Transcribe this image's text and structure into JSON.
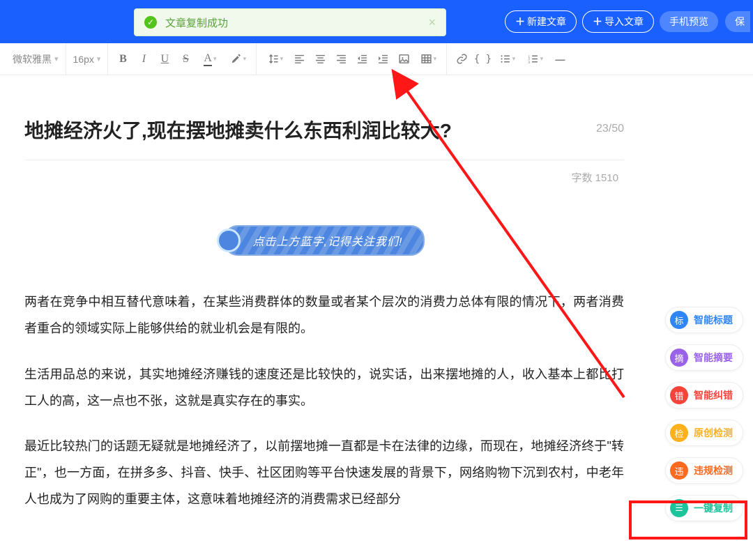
{
  "header": {
    "new_article_label": "新建文章",
    "import_article_label": "导入文章",
    "mobile_preview_label": "手机预览",
    "save_partial_label": "保"
  },
  "toast": {
    "message": "文章复制成功"
  },
  "toolbar": {
    "font_family": "微软雅黑",
    "font_size": "16px"
  },
  "document": {
    "title": "地摊经济火了,现在摆地摊卖什么东西利润比较大?",
    "char_count": "23/50",
    "word_count": "字数 1510",
    "banner_text": "点击上方蓝字,记得关注我们!",
    "paragraphs": [
      "两者在竞争中相互替代意味着，在某些消费群体的数量或者某个层次的消费力总体有限的情况下，两者消费者重合的领域实际上能够供给的就业机会是有限的。",
      "生活用品总的来说，其实地摊经济赚钱的速度还是比较快的，说实话，出来摆地摊的人，收入基本上都比打工人的高，这一点也不张，这就是真实存在的事实。",
      "最近比较热门的话题无疑就是地摊经济了，以前摆地摊一直都是卡在法律的边缘，而现在，地摊经济终于\"转正\"，也一方面，在拼多多、抖音、快手、社区团购等平台快速发展的背景下，网络购物下沉到农村，中老年人也成为了网购的重要主体，这意味着地摊经济的消费需求已经部分"
    ]
  },
  "side_actions": [
    {
      "badge": "标",
      "label": "智能标题",
      "color": "blue"
    },
    {
      "badge": "摘",
      "label": "智能摘要",
      "color": "purple"
    },
    {
      "badge": "错",
      "label": "智能纠错",
      "color": "red"
    },
    {
      "badge": "检",
      "label": "原创检测",
      "color": "yellow"
    },
    {
      "badge": "违",
      "label": "违规检测",
      "color": "orange"
    },
    {
      "badge": "☰",
      "label": "一键复制",
      "color": "teal"
    }
  ]
}
